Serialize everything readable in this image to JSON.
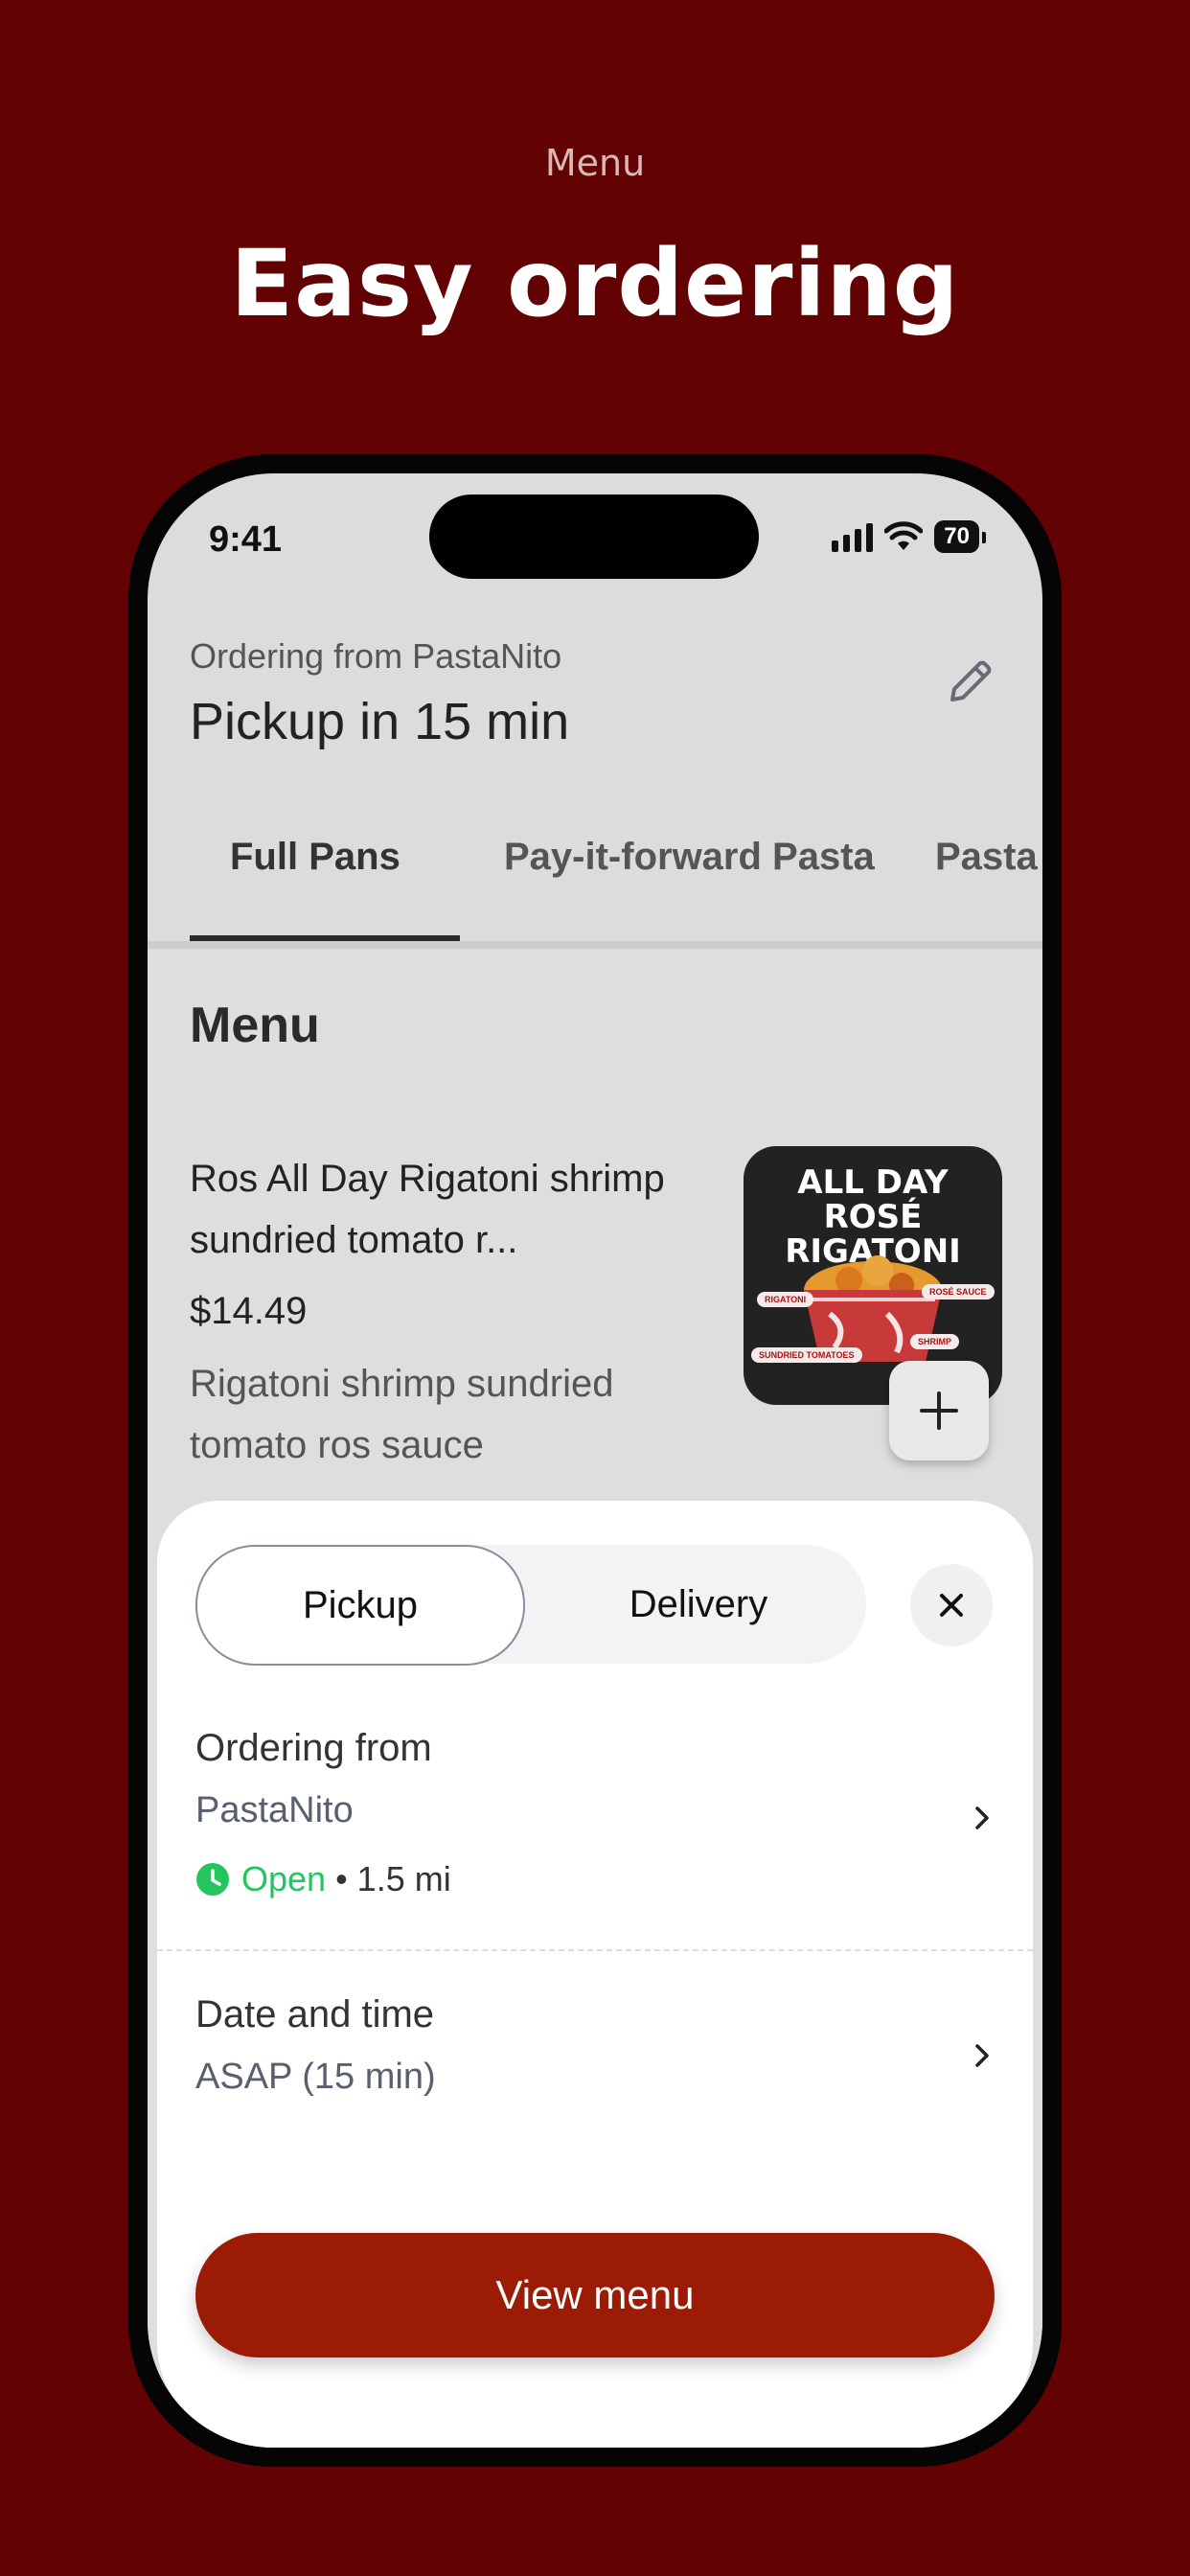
{
  "hero": {
    "subtitle": "Menu",
    "title": "Easy ordering"
  },
  "status_bar": {
    "time": "9:41",
    "battery": "70"
  },
  "header": {
    "ordering_from": "Ordering from PastaNito",
    "pickup_time": "Pickup in 15 min"
  },
  "tabs": [
    {
      "label": "Full Pans",
      "active": true
    },
    {
      "label": "Pay-it-forward Pasta",
      "active": false
    },
    {
      "label": "Pasta",
      "active": false
    }
  ],
  "menu": {
    "heading": "Menu",
    "item": {
      "name": "Ros All Day Rigatoni shrimp sundried tomato r...",
      "price": "$14.49",
      "description": "Rigatoni shrimp sundried tomato ros sauce",
      "image_title": "ALL DAY ROSÉ RIGATONI",
      "image_labels": [
        "RIGATONI",
        "ROSÉ SAUCE",
        "SUNDRIED TOMATOES",
        "SHRIMP"
      ]
    }
  },
  "sheet": {
    "toggle": {
      "pickup": "Pickup",
      "delivery": "Delivery",
      "selected": "Pickup"
    },
    "ordering_from_label": "Ordering from",
    "restaurant": "PastaNito",
    "status": "Open",
    "distance": "• 1.5 mi",
    "date_time_label": "Date and time",
    "date_time_value": "ASAP (15 min)",
    "cta": "View menu"
  },
  "colors": {
    "background": "#620202",
    "accent": "#9b1b04",
    "open": "#22c55e"
  }
}
